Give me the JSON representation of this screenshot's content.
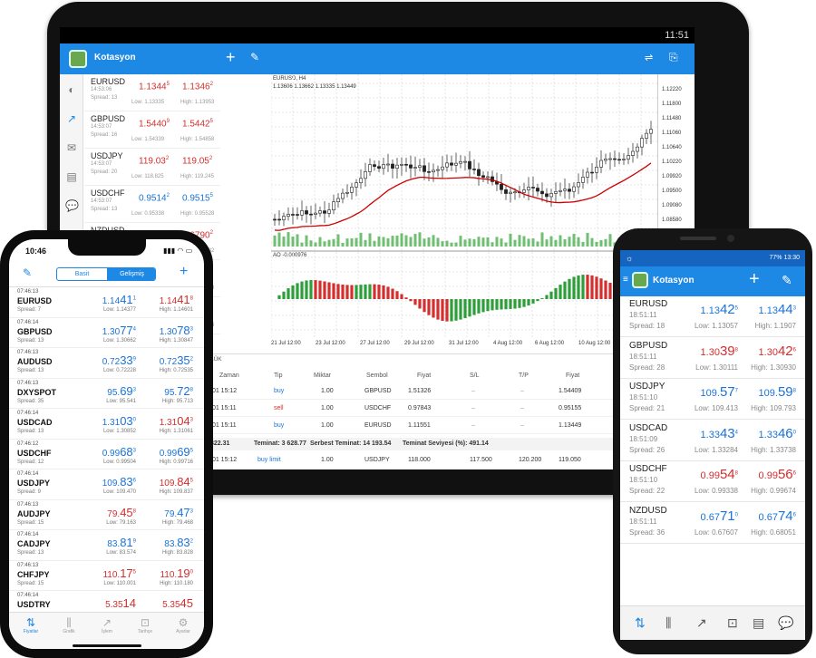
{
  "tablet": {
    "status_time": "11:51",
    "toolbar_title": "Kotasyon",
    "quotes": [
      {
        "symbol": "EURUSD",
        "time": "14:53:06",
        "spread": "Spread: 13",
        "bid_main": "1.1344",
        "bid_sup": "5",
        "ask_main": "1.1346",
        "ask_sup": "2",
        "low": "Low: 1.13335",
        "high": "High: 1.13953",
        "color": "red"
      },
      {
        "symbol": "GBPUSD",
        "time": "14:53:07",
        "spread": "Spread: 16",
        "bid_main": "1.5440",
        "bid_sup": "9",
        "ask_main": "1.5442",
        "ask_sup": "5",
        "low": "Low: 1.54339",
        "high": "High: 1.54858",
        "color": "red"
      },
      {
        "symbol": "USDJPY",
        "time": "14:53:07",
        "spread": "Spread: 20",
        "bid_main": "119.03",
        "bid_sup": "2",
        "ask_main": "119.05",
        "ask_sup": "2",
        "low": "Low: 118.825",
        "high": "High: 119.245",
        "color": "red"
      },
      {
        "symbol": "USDCHF",
        "time": "14:53:07",
        "spread": "Spread: 13",
        "bid_main": "0.9514",
        "bid_sup": "2",
        "ask_main": "0.9515",
        "ask_sup": "5",
        "low": "Low: 0.95338",
        "high": "High: 0.95528",
        "color": "blue"
      },
      {
        "symbol": "NZDUSD",
        "time": "",
        "spread": "",
        "bid_main": "",
        "bid_sup": "",
        "ask_main": "0.6790",
        "ask_sup": "2",
        "low": "",
        "high": "High: 0.68882",
        "color": "red"
      },
      {
        "symbol": "",
        "time": "",
        "spread": "",
        "bid_main": "",
        "bid_sup": "",
        "ask_main": "1.2905",
        "ask_sup": "4",
        "low": "",
        "high": "High: 1.29088",
        "color": "blue"
      },
      {
        "symbol": "",
        "time": "",
        "spread": "",
        "bid_main": "",
        "bid_sup": "",
        "ask_main": "0.7270",
        "ask_sup": "4",
        "low": "",
        "high": "High: 0.73364",
        "color": "red"
      },
      {
        "symbol": "",
        "time": "",
        "spread": "",
        "bid_main": "",
        "bid_sup": "",
        "ask_main": "0.7348",
        "ask_sup": "5",
        "low": "",
        "high": "",
        "color": "red"
      }
    ],
    "chart_header": "EURUSD, H4",
    "chart_ohlc": "1.13606 1.13662 1.13335 1.13449",
    "ao_label": "AO -0.000976",
    "y_ticks": [
      "1.12220",
      "1.11800",
      "1.11480",
      "1.11060",
      "1.10640",
      "1.10220",
      "1.09920",
      "1.09500",
      "1.09080",
      "1.08580"
    ],
    "x_ticks": [
      "21 Jul 12:00",
      "23 Jul 12:00",
      "27 Jul 12:00",
      "29 Jul 12:00",
      "31 Jul 12:00",
      "4 Aug 12:00",
      "6 Aug 12:00",
      "10 Aug 12:00"
    ],
    "trade": {
      "tab_label": "LÜK",
      "headers": [
        "Zaman",
        "Tip",
        "Miktar",
        "Sembol",
        "Fiyat",
        "S/L",
        "T/P",
        "Fiyat"
      ],
      "rows": [
        {
          "time": ".01 15:12",
          "type": "buy",
          "volume": "1.00",
          "symbol": "GBPUSD",
          "price": "1.51326",
          "sl": "",
          "tp": "",
          "cur": "1.54409"
        },
        {
          "time": ".01 15:11",
          "type": "sell",
          "volume": "1.00",
          "symbol": "USDCHF",
          "price": "0.97843",
          "sl": "",
          "tp": "",
          "cur": "0.95155"
        },
        {
          "time": ".01 15:11",
          "type": "buy",
          "volume": "1.00",
          "symbol": "EURUSD",
          "price": "1.11551",
          "sl": "",
          "tp": "",
          "cur": "1.13449"
        }
      ],
      "summary_balance": "822.31",
      "summary_margin": "Teminat: 3 628.77",
      "summary_free": "Serbest Teminat: 14 193.54",
      "summary_level": "Teminat Seviyesi (%): 491.14",
      "order": {
        "time": ".01 15:12",
        "type": "buy limit",
        "volume": "1.00",
        "symbol": "USDJPY",
        "price": "118.000",
        "sl": "117.500",
        "tp": "120.200",
        "cur": "119.050"
      }
    }
  },
  "iphone": {
    "status_time": "10:46",
    "segment_basic": "Basit",
    "segment_advanced": "Gelişmiş",
    "rows": [
      {
        "time": "07:46:13",
        "symbol": "EURUSD",
        "spread": "Spread: 7",
        "bid_a": "1.14",
        "bid_b": "41",
        "bid_c": "1",
        "ask_a": "1.14",
        "ask_b": "41",
        "ask_c": "8",
        "low": "Low: 1.14377",
        "high": "High: 1.14601",
        "bc": "blue",
        "ac": "red"
      },
      {
        "time": "07:46:14",
        "symbol": "GBPUSD",
        "spread": "Spread: 13",
        "bid_a": "1.30",
        "bid_b": "77",
        "bid_c": "4",
        "ask_a": "1.30",
        "ask_b": "78",
        "ask_c": "3",
        "low": "Low: 1.30662",
        "high": "High: 1.30847",
        "bc": "blue",
        "ac": "blue"
      },
      {
        "time": "07:46:13",
        "symbol": "AUDUSD",
        "spread": "Spread: 13",
        "bid_a": "0.72",
        "bid_b": "33",
        "bid_c": "9",
        "ask_a": "0.72",
        "ask_b": "35",
        "ask_c": "2",
        "low": "Low: 0.72228",
        "high": "High: 0.72535",
        "bc": "blue",
        "ac": "blue"
      },
      {
        "time": "07:46:13",
        "symbol": "DXYSPOT",
        "spread": "Spread: 35",
        "bid_a": "95.",
        "bid_b": "69",
        "bid_c": "3",
        "ask_a": "95.",
        "ask_b": "72",
        "ask_c": "8",
        "low": "Low: 95.541",
        "high": "High: 95.713",
        "bc": "blue",
        "ac": "blue"
      },
      {
        "time": "07:46:14",
        "symbol": "USDCAD",
        "spread": "Spread: 13",
        "bid_a": "1.31",
        "bid_b": "03",
        "bid_c": "0",
        "ask_a": "1.31",
        "ask_b": "04",
        "ask_c": "3",
        "low": "Low: 1.30852",
        "high": "High: 1.31061",
        "bc": "blue",
        "ac": "red"
      },
      {
        "time": "07:46:12",
        "symbol": "USDCHF",
        "spread": "Spread: 12",
        "bid_a": "0.99",
        "bid_b": "68",
        "bid_c": "3",
        "ask_a": "0.99",
        "ask_b": "69",
        "ask_c": "5",
        "low": "Low: 0.99504",
        "high": "High: 0.99716",
        "bc": "blue",
        "ac": "blue"
      },
      {
        "time": "07:46:14",
        "symbol": "USDJPY",
        "spread": "Spread: 9",
        "bid_a": "109.",
        "bid_b": "83",
        "bid_c": "6",
        "ask_a": "109.",
        "ask_b": "84",
        "ask_c": "5",
        "low": "Low: 109.470",
        "high": "High: 109.837",
        "bc": "blue",
        "ac": "red"
      },
      {
        "time": "07:46:13",
        "symbol": "AUDJPY",
        "spread": "Spread: 15",
        "bid_a": "79.",
        "bid_b": "45",
        "bid_c": "8",
        "ask_a": "79.",
        "ask_b": "47",
        "ask_c": "3",
        "low": "Low: 79.163",
        "high": "High: 79.468",
        "bc": "red",
        "ac": "blue"
      },
      {
        "time": "07:46:14",
        "symbol": "CADJPY",
        "spread": "Spread: 13",
        "bid_a": "83.",
        "bid_b": "81",
        "bid_c": "9",
        "ask_a": "83.",
        "ask_b": "83",
        "ask_c": "2",
        "low": "Low: 83.574",
        "high": "High: 83.828",
        "bc": "blue",
        "ac": "blue"
      },
      {
        "time": "07:46:13",
        "symbol": "CHFJPY",
        "spread": "Spread: 15",
        "bid_a": "110.",
        "bid_b": "17",
        "bid_c": "5",
        "ask_a": "110.",
        "ask_b": "19",
        "ask_c": "0",
        "low": "Low: 110.001",
        "high": "High: 110.180",
        "bc": "red",
        "ac": "red"
      },
      {
        "time": "07:46:14",
        "symbol": "USDTRY",
        "spread": "",
        "bid_a": "5.35",
        "bid_b": "14",
        "bid_c": "",
        "ask_a": "5.35",
        "ask_b": "45",
        "ask_c": "",
        "low": "",
        "high": "",
        "bc": "red",
        "ac": "red"
      }
    ],
    "tabs": [
      "Fiyatlar",
      "Grafik",
      "İşlem",
      "Tarihçe",
      "Ayarlar"
    ]
  },
  "android": {
    "status_time": "13:30",
    "status_battery": "77%",
    "toolbar_title": "Kotasyon",
    "rows": [
      {
        "symbol": "EURUSD",
        "time": "18:51:11",
        "spread": "Spread: 18",
        "bid_a": "1.13",
        "bid_b": "42",
        "bid_c": "5",
        "ask_a": "1.13",
        "ask_b": "44",
        "ask_c": "3",
        "low": "Low: 1.13057",
        "high": "High: 1.1907",
        "bc": "blue",
        "ac": "blue"
      },
      {
        "symbol": "GBPUSD",
        "time": "18:51:11",
        "spread": "Spread: 28",
        "bid_a": "1.30",
        "bid_b": "39",
        "bid_c": "8",
        "ask_a": "1.30",
        "ask_b": "42",
        "ask_c": "6",
        "low": "Low: 1.30111",
        "high": "High: 1.30930",
        "bc": "red",
        "ac": "red"
      },
      {
        "symbol": "USDJPY",
        "time": "18:51:10",
        "spread": "Spread: 21",
        "bid_a": "109.",
        "bid_b": "57",
        "bid_c": "7",
        "ask_a": "109.",
        "ask_b": "59",
        "ask_c": "8",
        "low": "Low: 109.413",
        "high": "High: 109.793",
        "bc": "blue",
        "ac": "blue"
      },
      {
        "symbol": "USDCAD",
        "time": "18:51:09",
        "spread": "Spread: 26",
        "bid_a": "1.33",
        "bid_b": "43",
        "bid_c": "4",
        "ask_a": "1.33",
        "ask_b": "46",
        "ask_c": "0",
        "low": "Low: 1.33284",
        "high": "High: 1.33738",
        "bc": "blue",
        "ac": "blue"
      },
      {
        "symbol": "USDCHF",
        "time": "18:51:10",
        "spread": "Spread: 22",
        "bid_a": "0.99",
        "bid_b": "54",
        "bid_c": "8",
        "ask_a": "0.99",
        "ask_b": "56",
        "ask_c": "6",
        "low": "Low: 0.99338",
        "high": "High: 0.99674",
        "bc": "red",
        "ac": "red"
      },
      {
        "symbol": "NZDUSD",
        "time": "18:51:11",
        "spread": "Spread: 36",
        "bid_a": "0.67",
        "bid_b": "71",
        "bid_c": "0",
        "ask_a": "0.67",
        "ask_b": "74",
        "ask_c": "6",
        "low": "Low: 0.67607",
        "high": "High: 0.68051",
        "bc": "blue",
        "ac": "blue"
      }
    ]
  },
  "colors": {
    "accent": "#1e88e5",
    "bid_up": "#1a73d9",
    "bid_down": "#d32f2f",
    "ma_line": "#cc0000",
    "ao_up": "#2e9e3a",
    "ao_down": "#d32f2f"
  }
}
